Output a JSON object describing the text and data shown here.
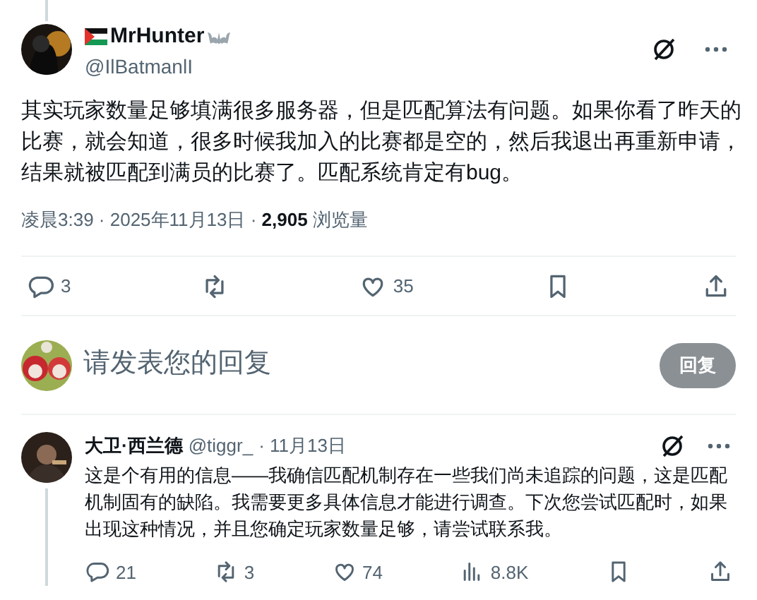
{
  "post": {
    "display_name": "MrHunter",
    "handle": "@IlBatmanlI",
    "text": "其实玩家数量足够填满很多服务器，但是匹配算法有问题。如果你看了昨天的比赛，就会知道，很多时候我加入的比赛都是空的，然后我退出再重新申请，结果就被匹配到满员的比赛了。匹配系统肯定有bug。",
    "time": "凌晨3:39 · 2025年11月13日 · ",
    "views": "2,905",
    "views_label": " 浏览量",
    "actions": [
      {
        "kind": "reply",
        "count": "3"
      },
      {
        "kind": "repost"
      },
      {
        "kind": "like",
        "count": "35"
      },
      {
        "kind": "bookmark"
      },
      {
        "kind": "share"
      }
    ]
  },
  "composer": {
    "placeholder": "请发表您的回复",
    "button": "回复",
    "disabled": true
  },
  "reply": {
    "display_name": "大卫·西兰德",
    "handle": "@tiggr_",
    "date": "· 11月13日",
    "text": "这是个有用的信息——我确信匹配机制存在一些我们尚未追踪的问题，这是匹配机制固有的缺陷。我需要更多具体信息才能进行调查。下次您尝试匹配时，如果出现这种情况，并且您确定玩家数量足够，请尝试联系我。",
    "actions": [
      {
        "kind": "reply",
        "count": "21"
      },
      {
        "kind": "repost",
        "count": "3"
      },
      {
        "kind": "like",
        "count": "74"
      },
      {
        "kind": "views",
        "count": "8.8K"
      },
      {
        "kind": "bookmark"
      },
      {
        "kind": "share"
      }
    ]
  }
}
